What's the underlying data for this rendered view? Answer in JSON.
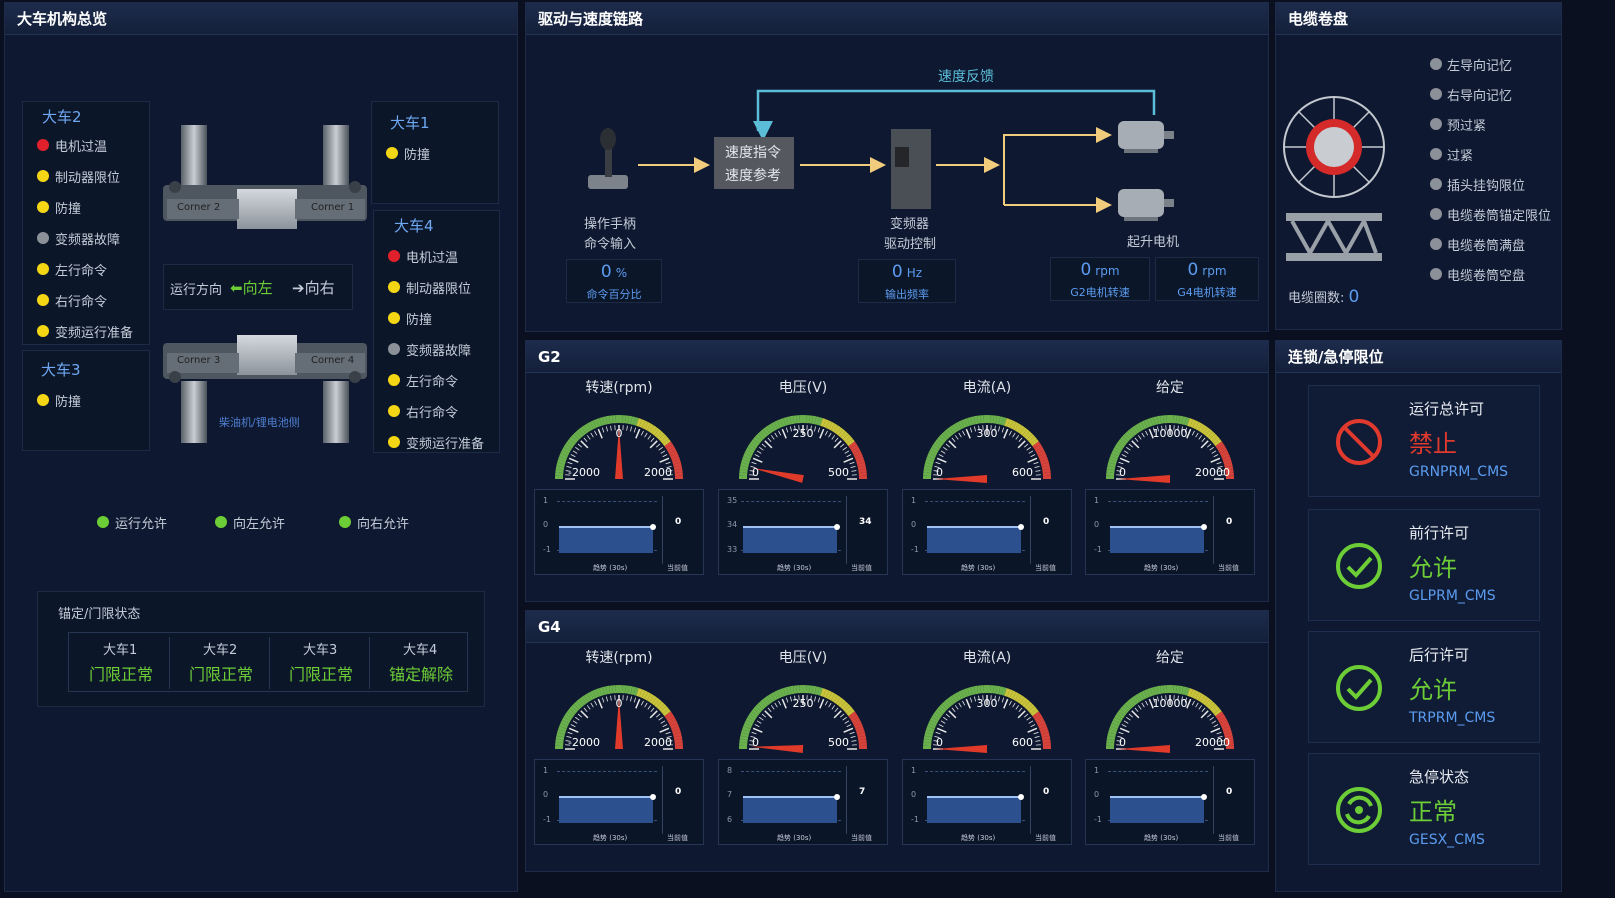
{
  "colors": {
    "red": "#e0202a",
    "yellow": "#f5d614",
    "gray": "#8c9099",
    "green": "#6ccd36",
    "accent": "#5b9cf0",
    "bg": "#0a1020"
  },
  "p1": {
    "title": "大车机构总览",
    "c2": {
      "name": "大车2",
      "items": [
        {
          "label": "电机过温",
          "color": "red"
        },
        {
          "label": "制动器限位",
          "color": "yellow"
        },
        {
          "label": "防撞",
          "color": "yellow"
        },
        {
          "label": "变频器故障",
          "color": "gray"
        },
        {
          "label": "左行命令",
          "color": "yellow"
        },
        {
          "label": "右行命令",
          "color": "yellow"
        },
        {
          "label": "变频运行准备",
          "color": "yellow"
        }
      ]
    },
    "c1": {
      "name": "大车1",
      "items": [
        {
          "label": "防撞",
          "color": "yellow"
        }
      ]
    },
    "c3": {
      "name": "大车3",
      "items": [
        {
          "label": "防撞",
          "color": "yellow"
        }
      ]
    },
    "c4": {
      "name": "大车4",
      "items": [
        {
          "label": "电机过温",
          "color": "red"
        },
        {
          "label": "制动器限位",
          "color": "yellow"
        },
        {
          "label": "防撞",
          "color": "yellow"
        },
        {
          "label": "变频器故障",
          "color": "gray"
        },
        {
          "label": "左行命令",
          "color": "yellow"
        },
        {
          "label": "右行命令",
          "color": "yellow"
        },
        {
          "label": "变频运行准备",
          "color": "yellow"
        }
      ]
    },
    "corners": [
      "Corner 2",
      "Corner 1",
      "Corner 3",
      "Corner 4"
    ],
    "dir": {
      "label": "运行方向",
      "left": "向左",
      "right": "向右"
    },
    "generator": "柴油机/锂电池侧",
    "permits": [
      "运行允许",
      "向左允许",
      "向右允许"
    ],
    "lock": {
      "title": "锚定/门限状态",
      "cols": [
        {
          "name": "大车1",
          "status": "门限正常"
        },
        {
          "name": "大车2",
          "status": "门限正常"
        },
        {
          "name": "大车3",
          "status": "门限正常"
        },
        {
          "name": "大车4",
          "status": "锚定解除"
        }
      ]
    }
  },
  "p2": {
    "title": "驱动与速度链路",
    "feedback": "速度反馈",
    "cmd": [
      "速度指令",
      "速度参考"
    ],
    "handle": [
      "操作手柄",
      "命令输入"
    ],
    "vfd": [
      "变频器",
      "驱动控制"
    ],
    "motor": "起升电机",
    "readouts": [
      {
        "value": "0",
        "unit": "%",
        "label": "命令百分比"
      },
      {
        "value": "0",
        "unit": "Hz",
        "label": "输出频率"
      },
      {
        "value": "0",
        "unit": "rpm",
        "label": "G2电机转速"
      },
      {
        "value": "0",
        "unit": "rpm",
        "label": "G4电机转速"
      }
    ]
  },
  "p3": {
    "title": "电缆卷盘",
    "items": [
      "左导向记忆",
      "右导向记忆",
      "预过紧",
      "过紧",
      "插头挂钩限位",
      "电缆卷筒锚定限位",
      "电缆卷筒满盘",
      "电缆卷筒空盘"
    ],
    "turns_label": "电缆圈数:",
    "turns_value": "0"
  },
  "g2": {
    "title": "G2",
    "gauges": [
      {
        "title": "转速(rpm)",
        "min": "-2000",
        "mid": "0",
        "max": "2000",
        "value": 0,
        "range": [
          -2000,
          2000
        ],
        "trend": {
          "top": "1",
          "mid": "0",
          "bot": "-1",
          "current": "0",
          "level": 0.5
        }
      },
      {
        "title": "电压(V)",
        "min": "0",
        "mid": "250",
        "max": "500",
        "value": 34,
        "range": [
          0,
          500
        ],
        "trend": {
          "top": "35",
          "mid": "34",
          "bot": "33",
          "current": "34",
          "level": 0.5
        }
      },
      {
        "title": "电流(A)",
        "min": "0",
        "mid": "300",
        "max": "600",
        "value": 0,
        "range": [
          0,
          600
        ],
        "trend": {
          "top": "1",
          "mid": "0",
          "bot": "-1",
          "current": "0",
          "level": 0.5
        }
      },
      {
        "title": "给定",
        "min": "0",
        "mid": "10000",
        "max": "20000",
        "value": 0,
        "range": [
          0,
          20000
        ],
        "trend": {
          "top": "1",
          "mid": "0",
          "bot": "-1",
          "current": "0",
          "level": 0.5
        }
      }
    ]
  },
  "g4": {
    "title": "G4",
    "gauges": [
      {
        "title": "转速(rpm)",
        "min": "-2000",
        "mid": "0",
        "max": "2000",
        "value": 0,
        "range": [
          -2000,
          2000
        ],
        "trend": {
          "top": "1",
          "mid": "0",
          "bot": "-1",
          "current": "0",
          "level": 0.5
        }
      },
      {
        "title": "电压(V)",
        "min": "0",
        "mid": "250",
        "max": "500",
        "value": 7,
        "range": [
          0,
          500
        ],
        "trend": {
          "top": "8",
          "mid": "7",
          "bot": "6",
          "current": "7",
          "level": 0.5
        }
      },
      {
        "title": "电流(A)",
        "min": "0",
        "mid": "300",
        "max": "600",
        "value": 0,
        "range": [
          0,
          600
        ],
        "trend": {
          "top": "1",
          "mid": "0",
          "bot": "-1",
          "current": "0",
          "level": 0.5
        }
      },
      {
        "title": "给定",
        "min": "0",
        "mid": "10000",
        "max": "20000",
        "value": 0,
        "range": [
          0,
          20000
        ],
        "trend": {
          "top": "1",
          "mid": "0",
          "bot": "-1",
          "current": "0",
          "level": 0.5
        }
      }
    ]
  },
  "trend_x": "趋势 (30s)",
  "trend_cur": "当前值",
  "p4": {
    "title": "连锁/急停限位",
    "cards": [
      {
        "title": "运行总许可",
        "status": "禁止",
        "code": "GRNPRM_CMS",
        "kind": "deny"
      },
      {
        "title": "前行许可",
        "status": "允许",
        "code": "GLPRM_CMS",
        "kind": "ok"
      },
      {
        "title": "后行许可",
        "status": "允许",
        "code": "TRPRM_CMS",
        "kind": "ok"
      },
      {
        "title": "急停状态",
        "status": "正常",
        "code": "GESX_CMS",
        "kind": "normal"
      }
    ]
  }
}
